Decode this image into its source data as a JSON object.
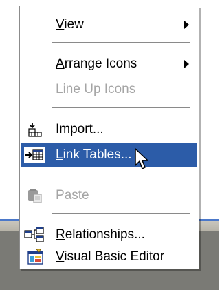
{
  "menu": {
    "items": [
      {
        "label": "View",
        "mnemonic": "V",
        "rest": "iew"
      },
      {
        "label": "Arrange Icons",
        "mnemonic": "A",
        "rest": "rrange Icons"
      },
      {
        "label": "Line Up Icons",
        "pre": "Line ",
        "mnemonic": "U",
        "rest": "p Icons"
      },
      {
        "label": "Import...",
        "mnemonic": "I",
        "rest": "mport..."
      },
      {
        "label": "Link Tables...",
        "mnemonic": "L",
        "rest": "ink Tables..."
      },
      {
        "label": "Paste",
        "mnemonic": "P",
        "rest": "aste"
      },
      {
        "label": "Relationships...",
        "mnemonic": "R",
        "rest": "elationships..."
      },
      {
        "label": "Visual Basic Editor",
        "mnemonic": "V",
        "rest": "isual Basic Editor"
      }
    ]
  },
  "icons": {
    "import": "import-table-icon",
    "link_tables": "link-tables-icon",
    "paste": "paste-clipboard-icon",
    "relationships": "relationships-icon",
    "vba": "visual-basic-editor-icon",
    "cursor": "mouse-pointer-icon"
  },
  "colors": {
    "highlight": "#2c5ca8",
    "disabled_text": "#a5a5a5"
  }
}
